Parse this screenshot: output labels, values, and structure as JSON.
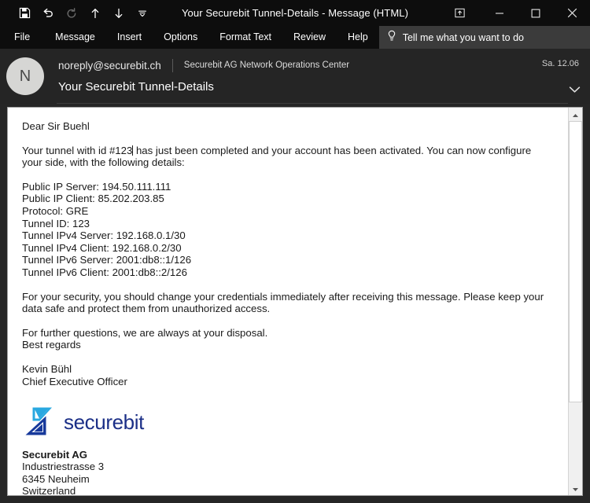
{
  "window": {
    "title": "Your Securebit Tunnel-Details  -  Message (HTML)"
  },
  "quick_access": {
    "items": [
      {
        "name": "save-icon",
        "label": "Save",
        "disabled": false
      },
      {
        "name": "undo-icon",
        "label": "Undo",
        "disabled": false
      },
      {
        "name": "redo-icon",
        "label": "Redo",
        "disabled": true
      },
      {
        "name": "previous-item-icon",
        "label": "Previous Item",
        "disabled": false
      },
      {
        "name": "next-item-icon",
        "label": "Next Item",
        "disabled": false
      },
      {
        "name": "customize-quick-access-toolbar-icon",
        "label": "Customize Quick Access Toolbar",
        "disabled": false
      }
    ]
  },
  "window_controls": {
    "restore_up_label": "Restore Up Ribbon Display Options",
    "minimize_label": "Minimize",
    "maximize_label": "Maximize",
    "close_label": "Close"
  },
  "ribbon": {
    "tabs": [
      "File",
      "Message",
      "Insert",
      "Options",
      "Format Text",
      "Review",
      "Help"
    ],
    "tell_me": {
      "placeholder": "Tell me what you want to do",
      "icon": "lightbulb-icon"
    }
  },
  "message_header": {
    "avatar_initial": "N",
    "from_address": "noreply@securebit.ch",
    "from_display_name": "Securebit AG Network Operations Center",
    "date": "Sa. 12.06",
    "subject": "Your Securebit Tunnel-Details",
    "expand_icon": "chevron-down-icon"
  },
  "body": {
    "greeting": "Dear Sir Buehl",
    "intro_before_caret": "Your tunnel with id #123",
    "intro_after_caret": " has just been completed and your account has been activated. You can now configure your side, with the following details:",
    "details": [
      "Public IP Server: 194.50.111.111",
      "Public IP Client: 85.202.203.85",
      "Protocol: GRE",
      "Tunnel ID: 123",
      "Tunnel IPv4 Server: 192.168.0.1/30",
      "Tunnel IPv4 Client: 192.168.0.2/30",
      "Tunnel IPv6 Server: 2001:db8::1/126",
      "Tunnel IPv6 Client: 2001:db8::2/126"
    ],
    "security_note": "For your security, you should change your credentials immediately after receiving this message. Please keep your data safe and protect them from unauthorized access.",
    "closing_question": "For further questions, we are always at your disposal.",
    "closing_regards": "Best regards",
    "signer_name": "Kevin Bühl",
    "signer_title": "Chief Executive Officer",
    "logo": {
      "mark_name": "securebit-logo-mark",
      "wordmark": "securebit",
      "color_dark": "#17399b",
      "color_light": "#29a8e0"
    },
    "company": {
      "name": "Securebit AG",
      "street": "Industriestrasse 3",
      "city": "6345 Neuheim",
      "country": "Switzerland"
    }
  },
  "scrollbar": {
    "up_label": "Line up",
    "down_label": "Line down"
  },
  "colors": {
    "chrome_dark": "#0d0d0d",
    "header_dark": "#252525",
    "tellme_bg": "#3b3b3b",
    "body_bg": "#ffffff"
  }
}
